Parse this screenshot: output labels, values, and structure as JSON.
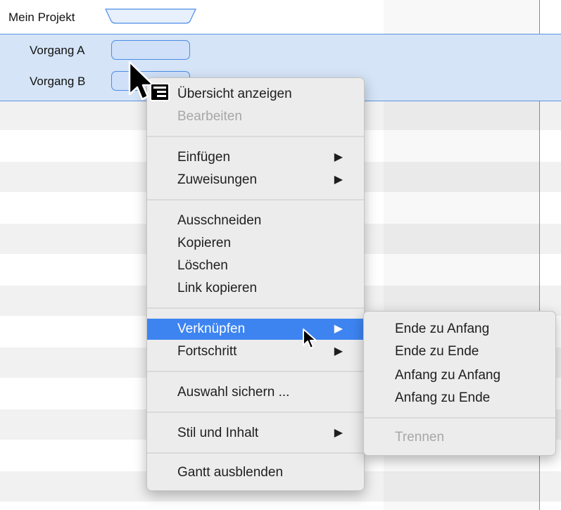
{
  "gantt": {
    "project_label": "Mein Projekt",
    "tasks": [
      "Vorgang A",
      "Vorgang B"
    ]
  },
  "context_menu": {
    "items": [
      {
        "label": "Übersicht anzeigen",
        "enabled": true
      },
      {
        "label": "Bearbeiten",
        "enabled": false
      },
      {
        "label": "Einfügen",
        "enabled": true,
        "submenu": true
      },
      {
        "label": "Zuweisungen",
        "enabled": true,
        "submenu": true
      },
      {
        "label": "Ausschneiden",
        "enabled": true
      },
      {
        "label": "Kopieren",
        "enabled": true
      },
      {
        "label": "Löschen",
        "enabled": true
      },
      {
        "label": "Link kopieren",
        "enabled": true
      },
      {
        "label": "Verknüpfen",
        "enabled": true,
        "submenu": true,
        "highlighted": true
      },
      {
        "label": "Fortschritt",
        "enabled": true,
        "submenu": true
      },
      {
        "label": "Auswahl sichern ...",
        "enabled": true
      },
      {
        "label": "Stil und Inhalt",
        "enabled": true,
        "submenu": true
      },
      {
        "label": "Gantt ausblenden",
        "enabled": true
      }
    ],
    "submenu_arrow": "▶"
  },
  "submenu": {
    "items": [
      {
        "label": "Ende zu Anfang",
        "enabled": true
      },
      {
        "label": "Ende zu Ende",
        "enabled": true
      },
      {
        "label": "Anfang zu Anfang",
        "enabled": true
      },
      {
        "label": "Anfang zu Ende",
        "enabled": true
      },
      {
        "label": "Trennen",
        "enabled": false
      }
    ]
  },
  "colors": {
    "highlight": "#3d84f1",
    "selection": "#d5e4f7",
    "bar_border": "#4a8ce6"
  },
  "icons": [
    "context-menu-cursor-icon",
    "arrow-cursor-icon",
    "submenu-arrow-icon"
  ]
}
